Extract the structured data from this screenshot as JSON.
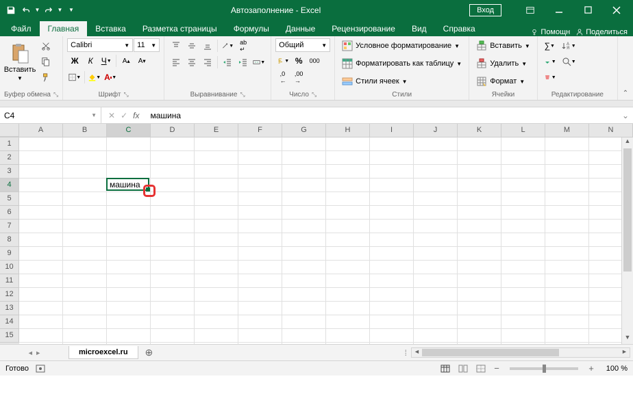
{
  "title": "Автозаполнение - Excel",
  "login": "Вход",
  "tabs": {
    "file": "Файл",
    "home": "Главная",
    "insert": "Вставка",
    "layout": "Разметка страницы",
    "formulas": "Формулы",
    "data": "Данные",
    "review": "Рецензирование",
    "view": "Вид",
    "help": "Справка",
    "tell": "Помощн",
    "share": "Поделиться"
  },
  "ribbon": {
    "clipboard": "Буфер обмена",
    "paste": "Вставить",
    "font_group": "Шрифт",
    "font_name": "Calibri",
    "font_size": "11",
    "alignment": "Выравнивание",
    "number": "Число",
    "number_format": "Общий",
    "styles": "Стили",
    "cond_format": "Условное форматирование",
    "format_table": "Форматировать как таблицу",
    "cell_styles": "Стили ячеек",
    "cells": "Ячейки",
    "insert_cells": "Вставить",
    "delete_cells": "Удалить",
    "format_cells": "Формат",
    "editing": "Редактирование"
  },
  "formula": {
    "cell_ref": "C4",
    "value": "машина"
  },
  "columns": [
    "A",
    "B",
    "C",
    "D",
    "E",
    "F",
    "G",
    "H",
    "I",
    "J",
    "K",
    "L",
    "M",
    "N"
  ],
  "rows": [
    "1",
    "2",
    "3",
    "4",
    "5",
    "6",
    "7",
    "8",
    "9",
    "10",
    "11",
    "12",
    "13",
    "14",
    "15"
  ],
  "active_cell": {
    "col": 2,
    "row": 3,
    "value": "машина"
  },
  "sheet": {
    "name": "microexcel.ru"
  },
  "status": {
    "ready": "Готово",
    "zoom": "100 %"
  }
}
